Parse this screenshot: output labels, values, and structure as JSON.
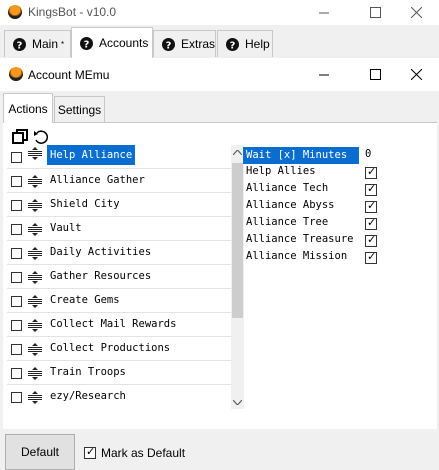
{
  "outer_window": {
    "title": "KingsBot - v10.0",
    "tabs": [
      {
        "label": "Main",
        "suffix": "*"
      },
      {
        "label": "Accounts"
      },
      {
        "label": "Extras"
      },
      {
        "label": "Help"
      }
    ]
  },
  "dialog": {
    "title": "Account MEmu",
    "tabs": [
      {
        "label": "Actions"
      },
      {
        "label": "Settings"
      }
    ]
  },
  "actions": [
    {
      "label": "Help Alliance",
      "checked": false,
      "selected": true
    },
    {
      "label": "Alliance Gather",
      "checked": false
    },
    {
      "label": "Shield City",
      "checked": false
    },
    {
      "label": "Vault",
      "checked": false
    },
    {
      "label": "Daily Activities",
      "checked": false
    },
    {
      "label": "Gather Resources",
      "checked": false
    },
    {
      "label": "Create Gems",
      "checked": false
    },
    {
      "label": "Collect Mail Rewards",
      "checked": false
    },
    {
      "label": "Collect Productions",
      "checked": false
    },
    {
      "label": "Train Troops",
      "checked": false
    },
    {
      "label": "ezy/Research",
      "checked": false
    }
  ],
  "options": [
    {
      "label": "Wait [x] Minutes",
      "value": "0",
      "highlight": true
    },
    {
      "label": "Help Allies",
      "checked": true
    },
    {
      "label": "Alliance Tech",
      "checked": true
    },
    {
      "label": "Alliance Abyss",
      "checked": true
    },
    {
      "label": "Alliance Tree",
      "checked": true
    },
    {
      "label": "Alliance Treasure",
      "checked": true
    },
    {
      "label": "Alliance Mission",
      "checked": true
    }
  ],
  "footer": {
    "default_button": "Default",
    "mark_default_label": "Mark as Default",
    "mark_default_checked": true
  },
  "colors": {
    "selection": "#0a6ed1"
  }
}
